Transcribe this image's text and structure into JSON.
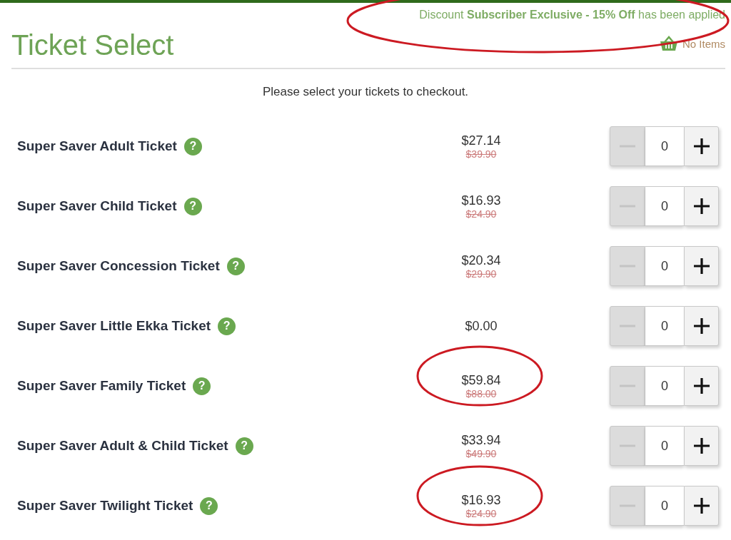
{
  "discount": {
    "prefix": "Discount",
    "offer": "Subscriber Exclusive - 15% Off",
    "suffix": "has been applied",
    "circled": true
  },
  "title": "Ticket Select",
  "cart": {
    "label": "No Items"
  },
  "instructions": "Please select your tickets to checkout.",
  "tickets": [
    {
      "name": "Super Saver Adult Ticket",
      "help": "?",
      "price": "$27.14",
      "original_price": "$39.90",
      "quantity": "0",
      "circled": false
    },
    {
      "name": "Super Saver Child Ticket",
      "help": "?",
      "price": "$16.93",
      "original_price": "$24.90",
      "quantity": "0",
      "circled": false
    },
    {
      "name": "Super Saver Concession Ticket",
      "help": "?",
      "price": "$20.34",
      "original_price": "$29.90",
      "quantity": "0",
      "circled": false
    },
    {
      "name": "Super Saver Little Ekka Ticket",
      "help": "?",
      "price": "$0.00",
      "quantity": "0",
      "circled": false
    },
    {
      "name": "Super Saver Family Ticket",
      "help": "?",
      "price": "$59.84",
      "original_price": "$88.00",
      "quantity": "0",
      "circled": true
    },
    {
      "name": "Super Saver Adult & Child Ticket",
      "help": "?",
      "price": "$33.94",
      "original_price": "$49.90",
      "quantity": "0",
      "circled": false
    },
    {
      "name": "Super Saver Twilight Ticket",
      "help": "?",
      "price": "$16.93",
      "original_price": "$24.90",
      "quantity": "0",
      "circled": true
    }
  ]
}
